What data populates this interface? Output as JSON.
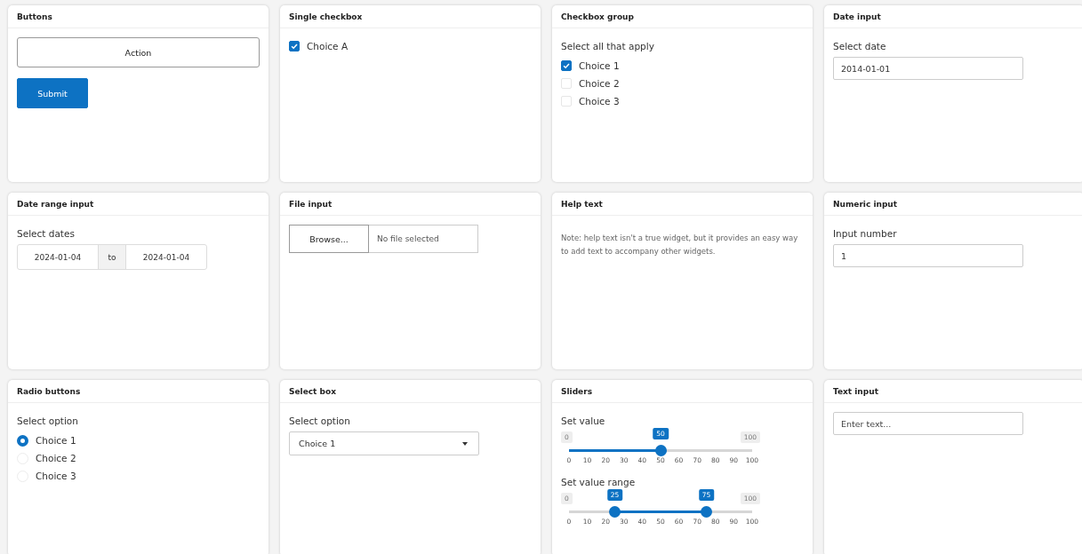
{
  "cards": [
    {
      "kind": "buttons",
      "title": "Buttons",
      "buttons": [
        {
          "label": "Action",
          "kind": "default"
        },
        {
          "label": "Submit",
          "kind": "primary"
        }
      ]
    },
    {
      "kind": "checkbox",
      "title": "Single checkbox",
      "options": [
        {
          "label": "Choice A",
          "checked": true
        }
      ]
    },
    {
      "kind": "checkbox_group",
      "title": "Checkbox group",
      "label": "Select all that apply",
      "options": [
        {
          "label": "Choice 1",
          "checked": true
        },
        {
          "label": "Choice 2",
          "checked": false
        },
        {
          "label": "Choice 3",
          "checked": false
        }
      ]
    },
    {
      "kind": "date",
      "title": "Date input",
      "label": "Select date",
      "value": "2014-01-01"
    },
    {
      "kind": "date_range",
      "title": "Date range input",
      "label": "Select dates",
      "start": "2024-01-04",
      "separator": "to",
      "end": "2024-01-04"
    },
    {
      "kind": "file",
      "title": "File input",
      "button": "Browse...",
      "value": "No file selected"
    },
    {
      "kind": "help",
      "title": "Help text",
      "text": "Note: help text isn't a true widget, but it provides an easy way to add text to accompany other widgets."
    },
    {
      "kind": "numeric",
      "title": "Numeric input",
      "label": "Input number",
      "value": "1"
    },
    {
      "kind": "radio",
      "title": "Radio buttons",
      "label": "Select option",
      "options": [
        {
          "label": "Choice 1",
          "selected": true
        },
        {
          "label": "Choice 2",
          "selected": false
        },
        {
          "label": "Choice 3",
          "selected": false
        }
      ]
    },
    {
      "kind": "select",
      "title": "Select box",
      "label": "Select option",
      "value": "Choice 1"
    },
    {
      "kind": "sliders",
      "title": "Sliders",
      "sliders": [
        {
          "label": "Set value",
          "min_label": "0",
          "max_label": "100",
          "ticks": [
            "0",
            "10",
            "20",
            "30",
            "40",
            "50",
            "60",
            "70",
            "80",
            "90",
            "100"
          ],
          "handles": [
            {
              "label": "50",
              "level": 0.5
            }
          ]
        },
        {
          "label": "Set value range",
          "min_label": "0",
          "max_label": "100",
          "ticks": [
            "0",
            "10",
            "20",
            "30",
            "40",
            "50",
            "60",
            "70",
            "80",
            "90",
            "100"
          ],
          "handles": [
            {
              "label": "25",
              "level": 0.25
            },
            {
              "label": "75",
              "level": 0.75
            }
          ]
        }
      ]
    },
    {
      "kind": "text",
      "title": "Text input",
      "placeholder": "Enter text..."
    }
  ]
}
